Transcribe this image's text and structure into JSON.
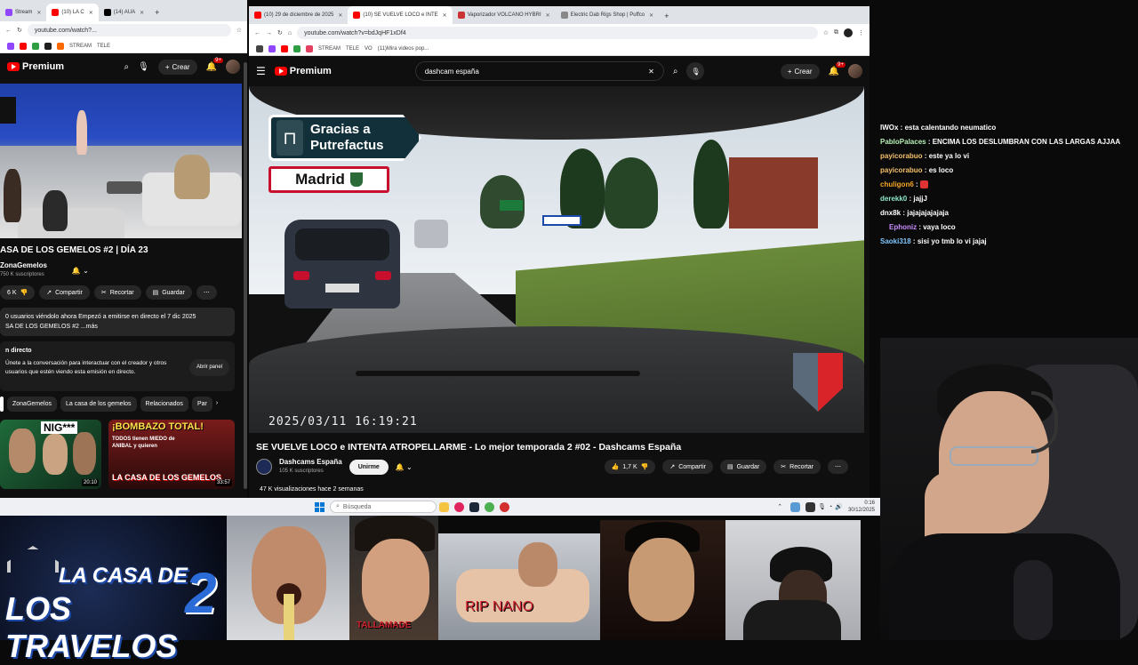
{
  "left_browser": {
    "tabs": [
      {
        "label": "Stream",
        "active": false
      },
      {
        "label": "(10) LA C",
        "active": true
      },
      {
        "label": "(14) AUA",
        "active": false
      }
    ],
    "url": "youtube.com/watch?...",
    "bookmarks": [
      "STREAM",
      "TELE"
    ],
    "brand": "Premium",
    "crear": "Crear",
    "notif_count": "9+",
    "video_title": "ASA DE LOS GEMELOS #2 | DÍA 23",
    "channel_name": "ZonaGemelos",
    "subscribers": "750 K suscriptores",
    "likes": "6 K",
    "share_label": "Compartir",
    "clip_label": "Recortar",
    "save_label": "Guardar",
    "desc_line1": "0 usuarios viéndolo ahora  Empezó a emitirse en directo el 7 dic 2025",
    "desc_line2": "SA DE LOS GEMELOS #2 ...más",
    "live_heading": "n directo",
    "live_text1": "Únete a la conversación para interactuar con el creador y otros",
    "live_text2": "usuarios que estén viendo esta emisión en directo.",
    "open_panel": "Abrir panel",
    "chips": [
      "ZonaGemelos",
      "La casa de los gemelos",
      "Relacionados",
      "Par"
    ],
    "thumb1_text": "NIG***",
    "thumb1_duration": "20:10",
    "thumb2_text": "¡BOMBAZO TOTAL!",
    "thumb2_sub": "TODOS tienen MIEDO de ANIBAL y quieren",
    "thumb2_bottom": "LA CASA DE LOS GEMELOS",
    "thumb2_duration": "33:57"
  },
  "main_browser": {
    "tabs": [
      {
        "label": "(10) 29 de diciembre de 2025",
        "active": false
      },
      {
        "label": "(10) SE VUELVE LOCO e INTE",
        "active": true
      },
      {
        "label": "Vaporizador VOLCANO HYBRI",
        "active": false
      },
      {
        "label": "Electric Dab Rigs Shop | Puffco",
        "active": false
      }
    ],
    "url": "youtube.com/watch?v=bdJqHF1xDf4",
    "bookmarks": [
      "STREAM",
      "TELE",
      "VO",
      "(11)Mira videos pop..."
    ],
    "brand": "Premium",
    "search_value": "dashcam españa",
    "crear": "Crear",
    "notif_count": "9+",
    "sign_text": "Gracias a Putrefactus",
    "sign_madrid": "Madrid",
    "timestamp": "2025/03/11  16:19:21",
    "video_title": "SE VUELVE LOCO e INTENTA ATROPELLARME - Lo mejor temporada 2 #02 - Dashcams España",
    "channel_name": "Dashcams España",
    "subscribers": "105 K suscriptores",
    "join_label": "Unirme",
    "likes": "1,7 K",
    "share_label": "Compartir",
    "save_label": "Guardar",
    "clip_label": "Recortar",
    "views": "47 K visualizaciones  hace 2 semanas"
  },
  "taskbar": {
    "search_placeholder": "Búsqueda",
    "time": "0:16",
    "date": "30/12/2025"
  },
  "chat": [
    {
      "user": "IWOx",
      "color": "#ffffff",
      "text": "esta calentando neumatico"
    },
    {
      "user": "PabloPalaces",
      "color": "#b6f0b6",
      "text": "ENCIMA LOS DESLUMBRAN CON LAS LARGAS AJJAA"
    },
    {
      "user": "payicorabuo",
      "color": "#f5c06a",
      "text": "este ya lo vi"
    },
    {
      "user": "payicorabuo",
      "color": "#f5c06a",
      "text": "es loco"
    },
    {
      "user": "chuligon6",
      "color": "#f5a623",
      "text": ""
    },
    {
      "user": "derekk0",
      "color": "#8ee6c8",
      "text": "jajjJ"
    },
    {
      "user": "dnx8k",
      "color": "#ffffff",
      "text": "jajajajajajaja"
    },
    {
      "user": "Ephoniz",
      "color": "#c88cff",
      "text": "vaya loco"
    },
    {
      "user": "Saoki318",
      "color": "#7fc7ff",
      "text": "sisi yo tmb lo vi jajaj"
    }
  ],
  "bottom": {
    "logo_line1": "LA CASA DE",
    "logo_line2": "LOS TRAVELOS",
    "logo_number": "2",
    "tile2_label": "TALLAMADE",
    "tile4_label": "RIP NANO"
  }
}
